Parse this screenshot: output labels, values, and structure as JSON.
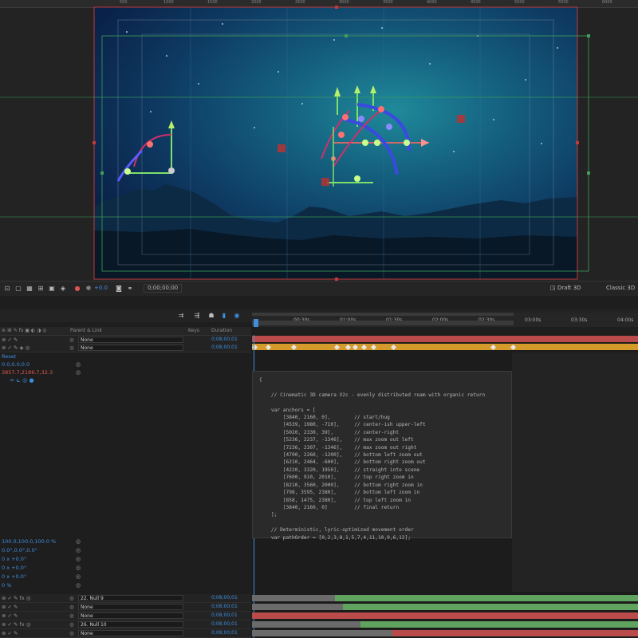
{
  "ruler": {
    "labels": [
      "500",
      "1000",
      "1500",
      "2000",
      "2500",
      "3000",
      "3500",
      "4000",
      "4500",
      "5000",
      "5500",
      "6000"
    ]
  },
  "viewer_toolbar": {
    "exposure": "+0.0",
    "timecode": "0;00;00;00",
    "renderer": "Draft 3D",
    "renderer_mode": "Classic 3D"
  },
  "timeline": {
    "time_labels": [
      "00:30s",
      "01:00s",
      "01:30s",
      "02:00s",
      "02:30s",
      "03:00s",
      "03:30s",
      "04:00s"
    ],
    "headers": {
      "parent_link": "Parent & Link",
      "keys": "Keys",
      "duration": "Duration"
    },
    "top_rows": [
      {
        "parent": "None",
        "duration": "0;08;00;01"
      },
      {
        "parent": "None",
        "duration": "0;08;00;01"
      }
    ],
    "props": {
      "reset": "Reset",
      "point": "0.0,0.0,0.0",
      "position": "3857.7,2186.7,32.3",
      "scale": "100.0,100.0,100.0 %",
      "orientation": "0.0°,0.0°,0.0°",
      "x_rotation": "0 x +0.0°",
      "y_rotation": "0 x +0.0°",
      "z_rotation": "0 x +0.0°",
      "opacity": "0 %"
    },
    "bottom_rows": [
      {
        "parent": "22. Null 9",
        "duration": "0;08;00;01"
      },
      {
        "parent": "None",
        "duration": "0;08;00;01"
      },
      {
        "parent": "None",
        "duration": "0;08;00;01"
      },
      {
        "parent": "26. Null 10",
        "duration": "0;08;00;01"
      },
      {
        "parent": "None",
        "duration": "0;08;00;01"
      }
    ],
    "bar_colors": {
      "red": "#b94b4b",
      "orange": "#d49a2a",
      "green": "#5fa35f",
      "grey": "#6b6b6b"
    }
  },
  "expression": {
    "lines": [
      "{",
      "",
      "    // Cinematic 3D camera V2c - evenly distributed roam with organic return",
      "",
      "    var anchors = [",
      "        [3840, 2160, 0],        // start/hug",
      "        [4539, 1980, -710],     // center-ish upper-left",
      "        [5020, 2330, 39],       // center-right",
      "        [5236, 2237, -1346],    // max zoom out left",
      "        [7236, 2307, -1346],    // max zoom out right",
      "        [4700, 2260, -1200],    // bottom left zoom out",
      "        [6210, 2464, -600],     // bottom right zoom out",
      "        [4220, 3320, 1950],     // straight into scene",
      "        [7600, 910, 2010],      // top right zoom in",
      "        [8210, 3560, 2000],     // bottom right zoom in",
      "        [798, 3595, 2380],      // bottom left zoom in",
      "        [858, 1475, 2380],      // top left zoom in",
      "        [3840, 2160, 0]         // final return",
      "    ];",
      "",
      "    // Deterministic, lyric-optimized movement order",
      "    var pathOrder = [0,2,3,8,1,5,7,4,11,10,9,6,12];"
    ]
  }
}
